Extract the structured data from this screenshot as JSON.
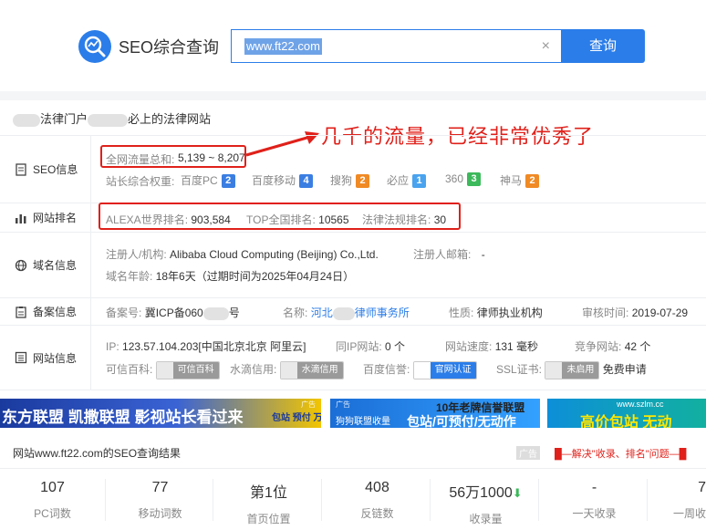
{
  "header": {
    "logo_text": "SEO综合查询",
    "search_value": "www.ft22.com",
    "search_button": "查询",
    "clear_glyph": "×"
  },
  "site": {
    "title_part1": "法律门户",
    "title_part2": "必上的法律网站"
  },
  "annotation": "几千的流量，已经非常优秀了",
  "seo_info": {
    "label": "SEO信息",
    "traffic_label": "全网流量总和:",
    "traffic_value": "5,139 ~ 8,207",
    "weight_label": "站长综合权重:",
    "weights": [
      {
        "name": "百度PC",
        "value": "2",
        "color": "#3b7ee2"
      },
      {
        "name": "百度移动",
        "value": "4",
        "color": "#3b7ee2"
      },
      {
        "name": "搜狗",
        "value": "2",
        "color": "#f08a24"
      },
      {
        "name": "必应",
        "value": "1",
        "color": "#4aa3ee"
      },
      {
        "name": "360",
        "value": "3",
        "color": "#3cb95b"
      },
      {
        "name": "神马",
        "value": "2",
        "color": "#f08a24"
      }
    ]
  },
  "rank": {
    "label": "网站排名",
    "alexa_label": "ALEXA世界排名:",
    "alexa_value": "903,584",
    "top_label": "TOP全国排名:",
    "top_value": "10565",
    "law_label": "法律法规排名:",
    "law_value": "30"
  },
  "domain": {
    "label": "域名信息",
    "registrant_label": "注册人/机构:",
    "registrant_value": "Alibaba Cloud Computing (Beijing) Co.,Ltd.",
    "email_label": "注册人邮箱:",
    "email_value": "-",
    "age_label": "域名年龄:",
    "age_value": "18年6天（过期时间为2025年04月24日）"
  },
  "icp": {
    "label": "备案信息",
    "no_label": "备案号:",
    "no_value_a": "冀ICP备060",
    "no_value_b": "号",
    "name_label": "名称:",
    "name_value_a": "河北",
    "name_value_b": "律师事务所",
    "nature_label": "性质:",
    "nature_value": "律师执业机构",
    "audit_label": "审核时间:",
    "audit_value": "2019-07-29"
  },
  "website": {
    "label": "网站信息",
    "ip_label": "IP:",
    "ip_value": "123.57.104.203[中国北京北京 阿里云]",
    "sameip_label": "同IP网站:",
    "sameip_value": "0 个",
    "speed_label": "网站速度:",
    "speed_value": "131 毫秒",
    "compete_label": "竞争网站:",
    "compete_value": "42 个",
    "baike_label": "可信百科:",
    "baike_pill": "可信百科",
    "shuidi_label": "水滴信用:",
    "shuidi_pill": "水滴信用",
    "baidu_label": "百度信誉:",
    "baidu_pill": "官网认证",
    "ssl_label": "SSL证书:",
    "ssl_pill": "未启用",
    "ssl_apply": "免费申请"
  },
  "ads": {
    "ad1_text": "东方联盟 凯撒联盟 影视站长看过来",
    "ad1_tag": "广告",
    "ad1_badge": "包站 预付 万IP",
    "ad2_tag": "广告",
    "ad2_top": "10年老牌信誉联盟",
    "ad2_bottom": "包站/可预付/无动作",
    "ad2_left": "狗狗联盟收量",
    "ad3_url": "www.szlm.cc",
    "ad3_text": "高价包站 无动"
  },
  "result": {
    "title": "网站www.ft22.com的SEO查询结果",
    "ad_label": "广告",
    "promo": "█—解决\"收录、排名\"问题—█"
  },
  "stats": [
    {
      "value": "107",
      "label": "PC词数"
    },
    {
      "value": "77",
      "label": "移动词数"
    },
    {
      "value": "第1位",
      "label": "首页位置"
    },
    {
      "value": "408",
      "label": "反链数"
    },
    {
      "value": "56万1000",
      "label": "收录量",
      "trend": "⬇"
    },
    {
      "value": "-",
      "label": "一天收录"
    },
    {
      "value": "7",
      "label": "一周收"
    }
  ]
}
